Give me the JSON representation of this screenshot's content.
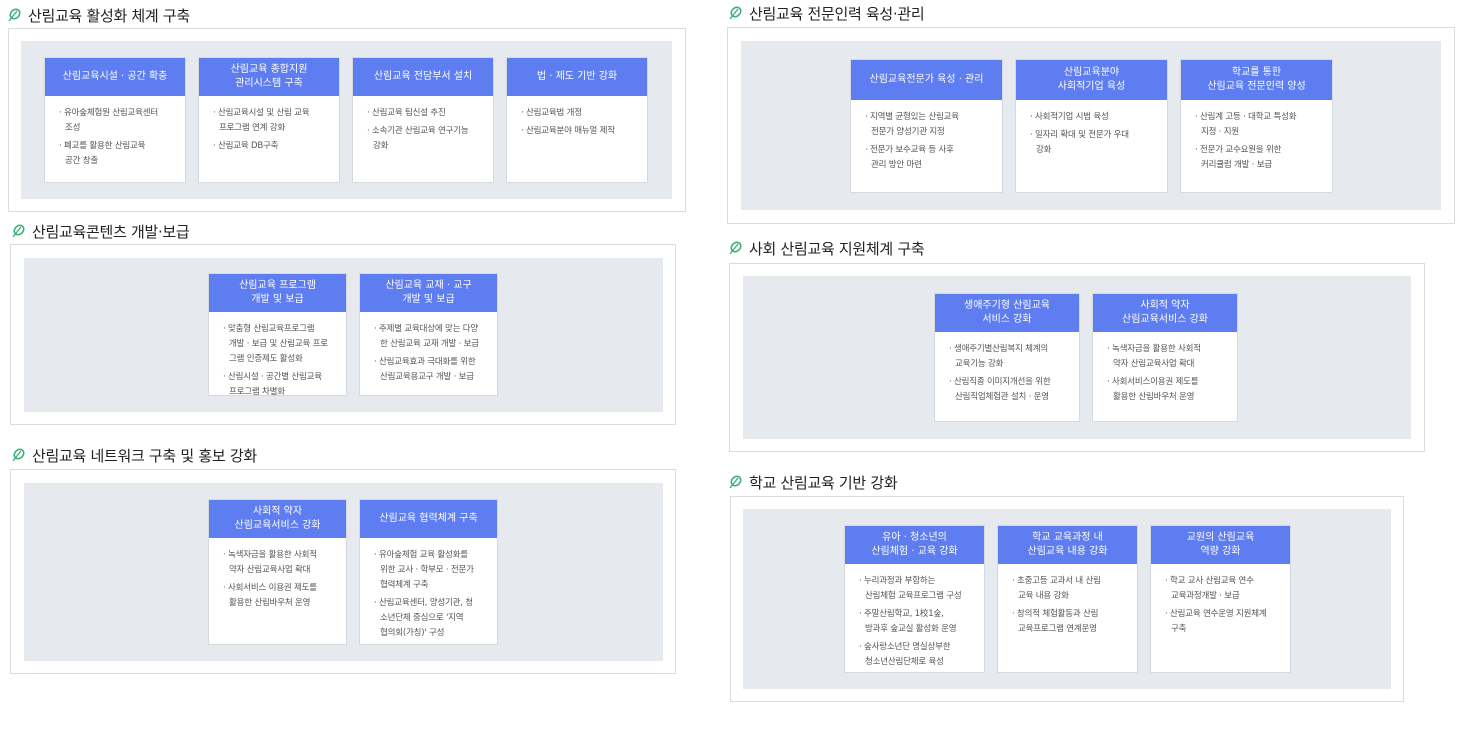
{
  "sections": [
    {
      "title": "산림교육 활성화 체계 구축",
      "cards": [
        {
          "title": [
            "산림교육시설 · 공간 확충"
          ],
          "items": [
            [
              "· 유아숲체험원 산림교육센터",
              "조성"
            ],
            [
              "· 폐교를 활용한 산림교육",
              "공간 창출"
            ]
          ]
        },
        {
          "title": [
            "산림교육 종합지원",
            "관리시스템 구축"
          ],
          "items": [
            [
              "· 산림교육시설 및 산림 교육",
              "프로그램 연계 강화"
            ],
            [
              "· 산림교육 DB구축"
            ]
          ]
        },
        {
          "title": [
            "산림교육 전담부서 설치"
          ],
          "items": [
            [
              "· 산림교육 팀신설 추진"
            ],
            [
              "· 소속기관 산림교육 연구기능",
              "강화"
            ]
          ]
        },
        {
          "title": [
            "법 · 제도 기반 강화"
          ],
          "items": [
            [
              "· 산림교육법 개정"
            ],
            [
              "· 산림교육분야 매뉴얼 제작"
            ]
          ]
        }
      ]
    },
    {
      "title": "산림교육콘텐츠 개발·보급",
      "cards": [
        {
          "title": [
            "산림교육 프로그램",
            "개발 및 보급"
          ],
          "items": [
            [
              "· 맞춤형 산림교육프로그램",
              "개발 · 보급 및 산림교육 프로",
              "그램 인증제도 활성화"
            ],
            [
              "· 산림시설 · 공간별 산림교육",
              "프로그램 차별화"
            ]
          ]
        },
        {
          "title": [
            "산림교육 교재 · 교구",
            "개발 및 보급"
          ],
          "items": [
            [
              "· 주제별 교육대상에 맞는 다양",
              "한 산림교육 교재 개발 · 보급"
            ],
            [
              "· 산림교육효과 극대화를 위한",
              "산림교육용교구 개발 · 보급"
            ]
          ]
        }
      ]
    },
    {
      "title": "산림교육 네트워크 구축 및 홍보 강화",
      "cards": [
        {
          "title": [
            "사회적 약자",
            "산림교육서비스 강화"
          ],
          "items": [
            [
              "· 녹색자금을 활용한 사회적",
              "약자 산림교육사업 확대"
            ],
            [
              "· 사회서비스 이용권 제도를",
              "활용한 산림바우처 운영"
            ]
          ]
        },
        {
          "title": [
            "산림교육 협력체계 구축"
          ],
          "items": [
            [
              "· 유아숲체험 교육 활성화를",
              "위한 교사 · 학부모 · 전문가",
              "협력체계 구축"
            ],
            [
              "· 산림교육센터, 양성기관, 청",
              "소년단체 중심으로 '지역",
              "협의회(가칭)' 구성"
            ]
          ]
        }
      ]
    },
    {
      "title": "산림교육 전문인력 육성·관리",
      "cards": [
        {
          "title": [
            "산림교육전문가 육성 · 관리"
          ],
          "items": [
            [
              "· 지역별 균형있는 산림교육",
              "전문가 양성기관 지정"
            ],
            [
              "· 전문가 보수교육 등 사후",
              "관리 방안 마련"
            ]
          ]
        },
        {
          "title": [
            "산림교육분야",
            "사회적기업 육성"
          ],
          "items": [
            [
              "· 사회적기업 시범 육성"
            ],
            [
              "· 일자리 확대 및 전문가 우대",
              "강화"
            ]
          ]
        },
        {
          "title": [
            "학교를 통한",
            "산림교육 전문인력 양성"
          ],
          "items": [
            [
              "· 산림계 고등 · 대학교 특성화",
              "지정 · 지원"
            ],
            [
              "· 전문가 교수요원을 위한",
              "커리큘럼 개발 · 보급"
            ]
          ]
        }
      ]
    },
    {
      "title": "사회 산림교육 지원체계 구축",
      "cards": [
        {
          "title": [
            "생애주기형 산림교육",
            "서비스 강화"
          ],
          "items": [
            [
              "· 생애주기별산림복지 체계의",
              "교육기능 강화"
            ],
            [
              "· 산림직종 이미지개선을 위한",
              "산림직업체험관 설치 · 운영"
            ]
          ]
        },
        {
          "title": [
            "사회적 약자",
            "산림교육서비스 강화"
          ],
          "items": [
            [
              "· 녹색자금을 활용한 사회적",
              "약자 산림교육사업 확대"
            ],
            [
              "· 사회서비스이용권 제도를",
              "활용한 산림바우처 운영"
            ]
          ]
        }
      ]
    },
    {
      "title": "학교 산림교육 기반 강화",
      "cards": [
        {
          "title": [
            "유아 · 청소년의",
            "산림체험 · 교육 강화"
          ],
          "items": [
            [
              "· 누리과정과 부합하는",
              "산림체험 교육프로그램 구성"
            ],
            [
              "· 주말산림학교, 1校1숲,",
              "방과후 숲교실 활성화 운영"
            ],
            [
              "· 숲사랑소년단 명실상부한",
              "청소년산림단체로 육성"
            ]
          ]
        },
        {
          "title": [
            "학교 교육과정 내",
            "산림교육 내용 강화"
          ],
          "items": [
            [
              "· 초중고등 교과서 내 산림",
              "교육 내용 강화"
            ],
            [
              "· 창의적 체험활동과 산림",
              "교육프로그램 연계운영"
            ]
          ]
        },
        {
          "title": [
            "교원의 산림교육",
            "역량 강화"
          ],
          "items": [
            [
              "· 학교 교사 산림교육 연수",
              "교육과정개발 · 보급"
            ],
            [
              "· 산림교육 연수운영 지원체계",
              "구축"
            ]
          ]
        }
      ]
    }
  ],
  "colors": {
    "accent": "#5e7df0",
    "inner_bg": "#e6eaee",
    "leaf_icon": "#3bb07a"
  }
}
